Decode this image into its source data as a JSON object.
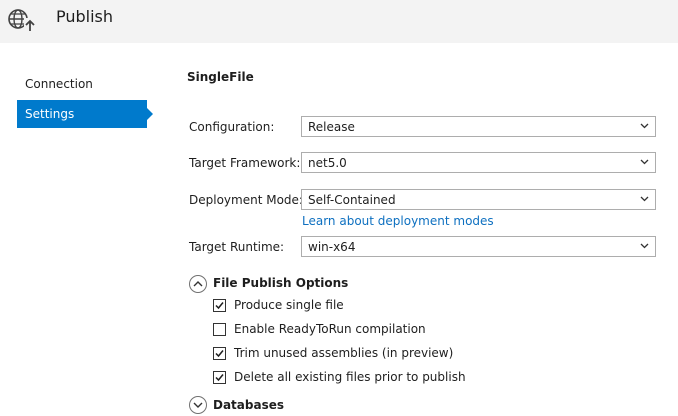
{
  "header": {
    "title": "Publish",
    "icon": "globe-publish-icon"
  },
  "sidebar": {
    "items": [
      {
        "label": "Connection",
        "active": false
      },
      {
        "label": "Settings",
        "active": true
      }
    ]
  },
  "main": {
    "title": "SingleFile",
    "fields": [
      {
        "label": "Configuration:",
        "value": "Release"
      },
      {
        "label": "Target Framework:",
        "value": "net5.0"
      },
      {
        "label": "Deployment Mode:",
        "value": "Self-Contained"
      },
      {
        "label": "Target Runtime:",
        "value": "win-x64"
      }
    ],
    "deployment_link": "Learn about deployment modes",
    "file_publish_options": {
      "title": "File Publish Options",
      "expanded": true,
      "options": [
        {
          "label": "Produce single file",
          "checked": true
        },
        {
          "label": "Enable ReadyToRun compilation",
          "checked": false
        },
        {
          "label": "Trim unused assemblies (in preview)",
          "checked": true
        },
        {
          "label": "Delete all existing files prior to publish",
          "checked": true
        }
      ]
    },
    "databases": {
      "title": "Databases",
      "expanded": false
    }
  },
  "colors": {
    "accent": "#007acc",
    "link": "#0e70c0",
    "header_bg": "#f3f3f3"
  }
}
